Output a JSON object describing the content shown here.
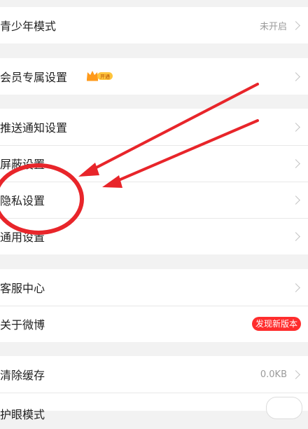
{
  "settings": {
    "teen_mode": {
      "label": "青少年模式",
      "status": "未开启"
    },
    "vip_settings": {
      "label": "会员专属设置",
      "badge_text": "开通"
    },
    "push_notification": {
      "label": "推送通知设置"
    },
    "block_settings": {
      "label": "屏蔽设置"
    },
    "privacy_settings": {
      "label": "隐私设置"
    },
    "general_settings": {
      "label": "通用设置"
    },
    "customer_service": {
      "label": "客服中心"
    },
    "about_weibo": {
      "label": "关于微博",
      "badge": "发现新版本"
    },
    "clear_cache": {
      "label": "清除缓存",
      "size": "0.0KB"
    },
    "eye_protection": {
      "label": "护眼模式"
    }
  },
  "colors": {
    "accent_red": "#ff2d2d",
    "annotation_red": "#e8252a"
  }
}
